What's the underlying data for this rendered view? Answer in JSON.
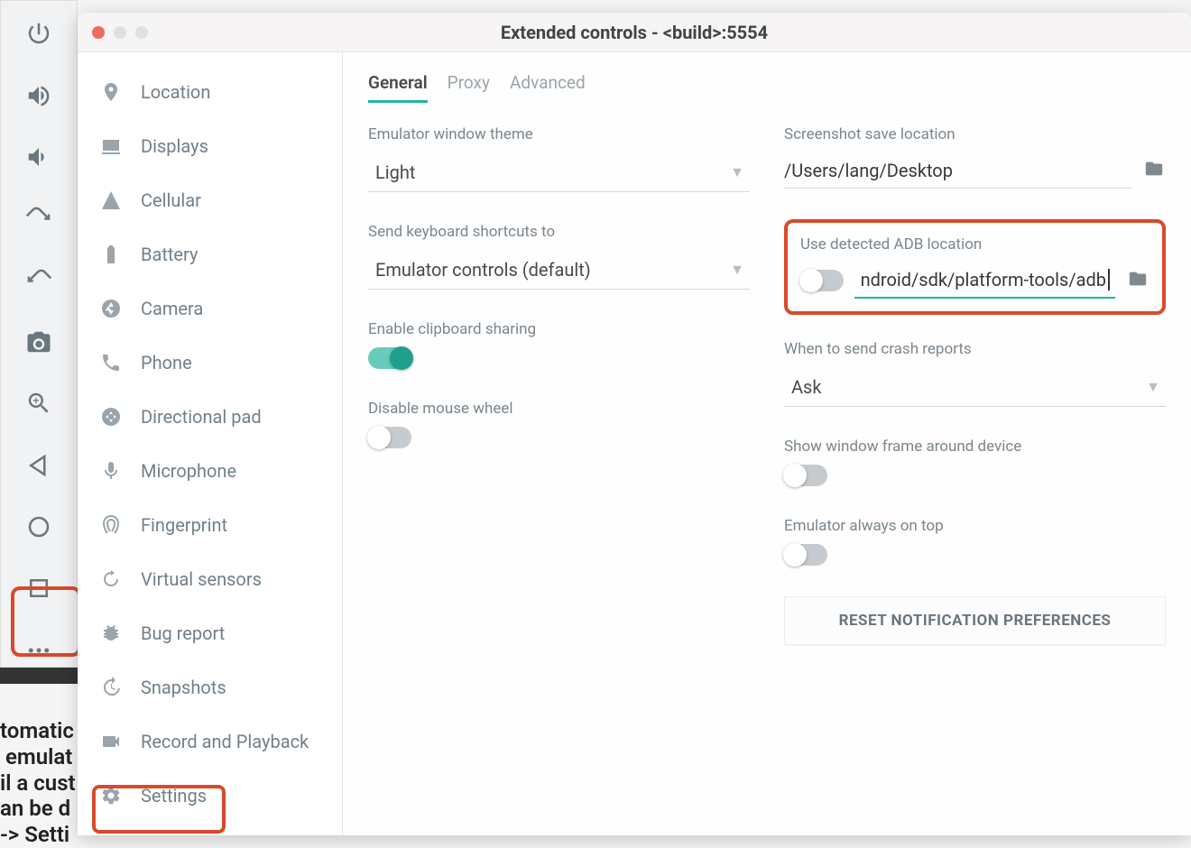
{
  "window": {
    "title": "Extended controls - <build>:5554"
  },
  "sidebar": {
    "items": [
      {
        "label": "Location"
      },
      {
        "label": "Displays"
      },
      {
        "label": "Cellular"
      },
      {
        "label": "Battery"
      },
      {
        "label": "Camera"
      },
      {
        "label": "Phone"
      },
      {
        "label": "Directional pad"
      },
      {
        "label": "Microphone"
      },
      {
        "label": "Fingerprint"
      },
      {
        "label": "Virtual sensors"
      },
      {
        "label": "Bug report"
      },
      {
        "label": "Snapshots"
      },
      {
        "label": "Record and Playback"
      },
      {
        "label": "Settings"
      }
    ]
  },
  "tabs": {
    "general": "General",
    "proxy": "Proxy",
    "advanced": "Advanced"
  },
  "settings": {
    "theme_label": "Emulator window theme",
    "theme_value": "Light",
    "shortcuts_label": "Send keyboard shortcuts to",
    "shortcuts_value": "Emulator controls (default)",
    "clipboard_label": "Enable clipboard sharing",
    "mousewheel_label": "Disable mouse wheel",
    "screenshot_label": "Screenshot save location",
    "screenshot_value": "/Users/lang/Desktop",
    "adb_label": "Use detected ADB location",
    "adb_value": "ndroid/sdk/platform-tools/adb",
    "crash_label": "When to send crash reports",
    "crash_value": "Ask",
    "show_frame_label": "Show window frame around device",
    "always_top_label": "Emulator always on top",
    "reset_label": "RESET NOTIFICATION PREFERENCES"
  },
  "bg_text": "tomatic\n emulat\nil a cust\nan be d\n-> Setti"
}
